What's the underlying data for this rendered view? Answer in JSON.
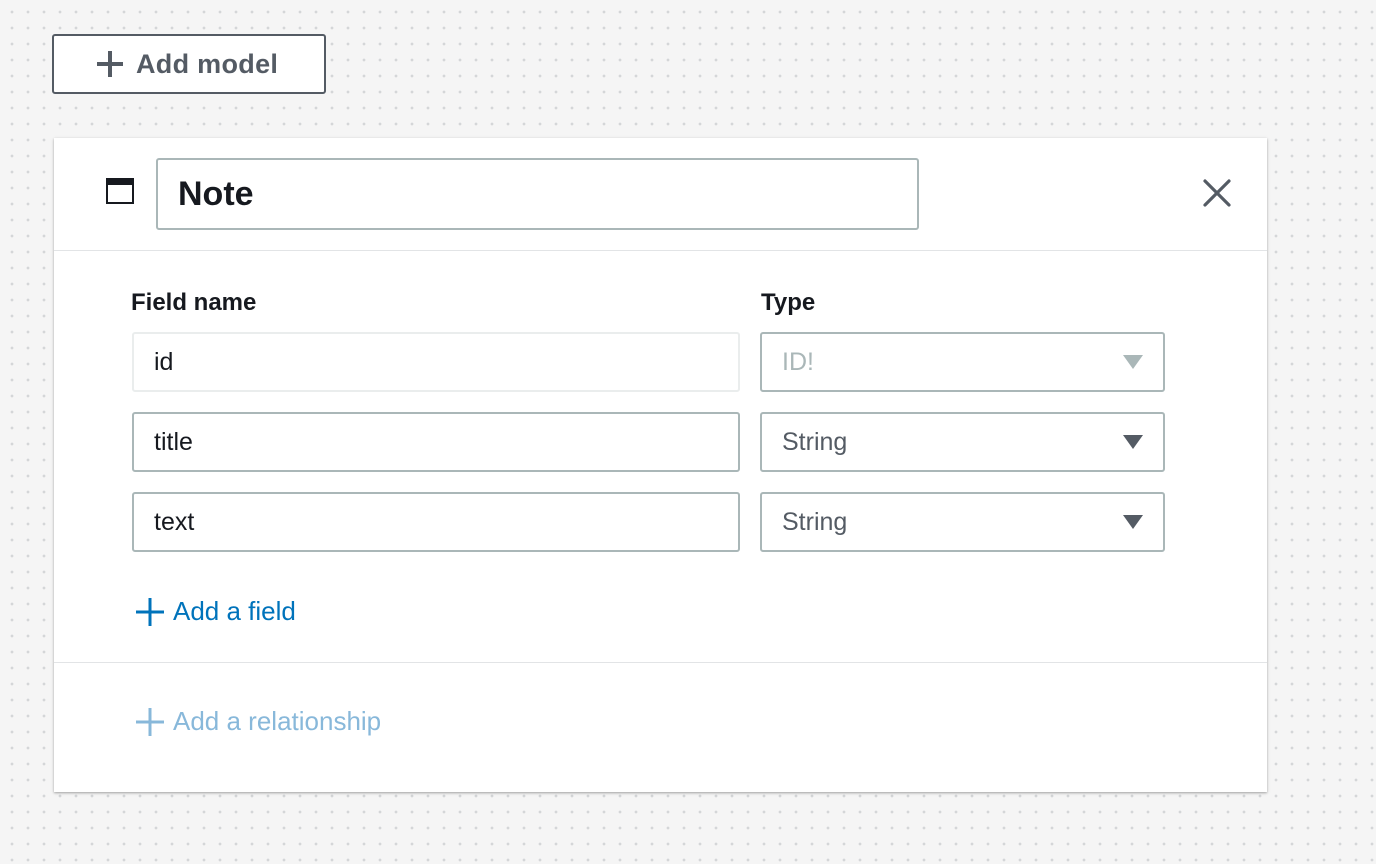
{
  "toolbar": {
    "add_model_label": "Add model",
    "add_icon": "plus-icon"
  },
  "model": {
    "icon": "table-icon",
    "name": "Note",
    "close_icon": "close-icon"
  },
  "fields": {
    "name_header": "Field name",
    "type_header": "Type",
    "rows": [
      {
        "name": "id",
        "type": "ID!",
        "disabled": true
      },
      {
        "name": "title",
        "type": "String",
        "disabled": false
      },
      {
        "name": "text",
        "type": "String",
        "disabled": false
      }
    ],
    "add_field_label": "Add a field"
  },
  "relationships": {
    "add_relationship_label": "Add a relationship",
    "enabled": false
  },
  "colors": {
    "link_blue": "#0073bb",
    "link_disabled": "#88b8da",
    "border": "#aab7b8",
    "text_secondary": "#545b64"
  }
}
